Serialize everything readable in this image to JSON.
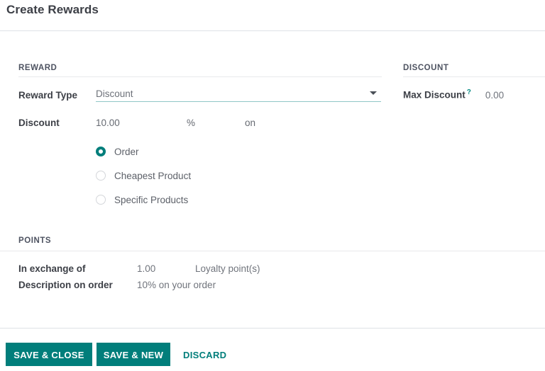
{
  "dialog": {
    "title": "Create Rewards"
  },
  "reward_section": {
    "title": "REWARD",
    "reward_type": {
      "label": "Reward Type",
      "value": "Discount",
      "caret_icon": "chevron-down-icon"
    },
    "discount": {
      "label": "Discount",
      "amount": "10.00",
      "unit": "%",
      "on": "on"
    },
    "applies_to": {
      "selected": "Order",
      "options": [
        {
          "label": "Order",
          "checked": true
        },
        {
          "label": "Cheapest Product",
          "checked": false
        },
        {
          "label": "Specific Products",
          "checked": false
        }
      ]
    }
  },
  "discount_section": {
    "title": "DISCOUNT",
    "max_discount": {
      "label": "Max Discount",
      "help_icon": "help-question-icon",
      "help_marker": "?",
      "value": "0.00"
    }
  },
  "points_section": {
    "title": "POINTS",
    "in_exchange_of": {
      "label": "In exchange of",
      "value": "1.00",
      "unit": "Loyalty point(s)"
    },
    "description_on_order": {
      "label": "Description on order",
      "value": "10% on your order"
    }
  },
  "footer": {
    "save_close_label": "SAVE & CLOSE",
    "save_new_label": "SAVE & NEW",
    "discard_label": "DISCARD"
  },
  "colors": {
    "accent": "#017e7b",
    "underline": "#8fc7c7",
    "label": "#3c3f46",
    "value": "#70747c",
    "divider": "#e8e9eb"
  }
}
